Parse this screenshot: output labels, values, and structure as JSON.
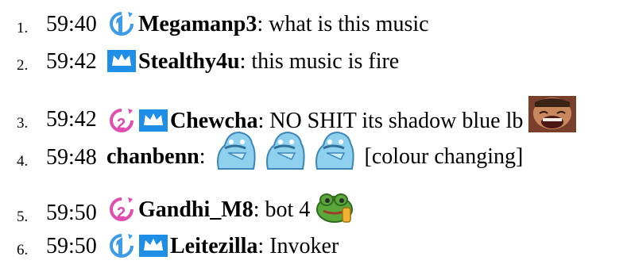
{
  "chat": {
    "messages": [
      {
        "index": "1.",
        "time": "59:40",
        "badges": [
          "sub-badge-1"
        ],
        "user": "Megamanp3",
        "sep": ":",
        "text": " what is this music"
      },
      {
        "index": "2.",
        "time": "59:42",
        "badges": [
          "crown-badge"
        ],
        "user": "Stealthy4u",
        "sep": ":",
        "text": " this music is fire"
      },
      {
        "index": "3.",
        "time": "59:42",
        "badges": [
          "sub-badge-2",
          "crown-badge"
        ],
        "user": "Chewcha",
        "sep": ":",
        "text": " NO SHIT its shadow blue lb ",
        "emotes": [
          "laughing-face-emote"
        ]
      },
      {
        "index": "4.",
        "time": "59:48",
        "badges": [],
        "user": "chanbenn",
        "sep": ":",
        "text": "",
        "emotes": [
          "blue-creature-emote",
          "blue-creature-emote",
          "blue-creature-emote"
        ],
        "note": "[colour changing]"
      },
      {
        "index": "5.",
        "time": "59:50",
        "badges": [
          "sub-badge-2"
        ],
        "user": "Gandhi_M8",
        "sep": ":",
        "text": " bot 4 ",
        "emotes": [
          "green-frog-emote"
        ]
      },
      {
        "index": "6.",
        "time": "59:50",
        "badges": [
          "sub-badge-1",
          "crown-badge"
        ],
        "user": "Leitezilla",
        "sep": ":",
        "text": " Invoker"
      }
    ]
  },
  "colors": {
    "sub_badge_1": "#3d9be9",
    "sub_badge_2": "#e04fb0",
    "crown_badge": "#1e8ee6"
  }
}
